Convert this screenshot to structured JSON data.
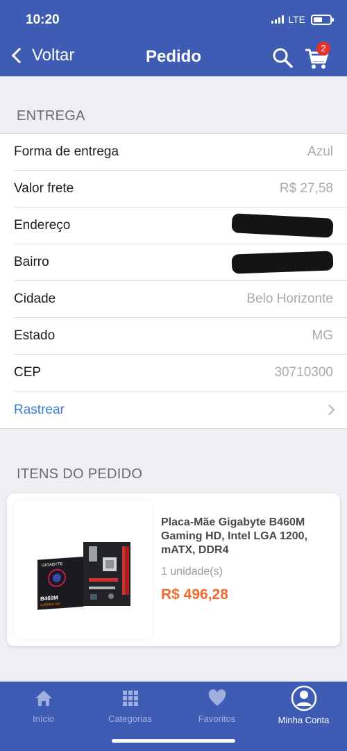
{
  "status_bar": {
    "time": "10:20",
    "network": "LTE"
  },
  "header": {
    "back_label": "Voltar",
    "title": "Pedido",
    "cart_badge": "2"
  },
  "delivery": {
    "section_title": "ENTREGA",
    "rows": [
      {
        "label": "Forma de entrega",
        "value": "Azul"
      },
      {
        "label": "Valor frete",
        "value": "R$ 27,58"
      },
      {
        "label": "Endereço",
        "value": ""
      },
      {
        "label": "Bairro",
        "value": ""
      },
      {
        "label": "Cidade",
        "value": "Belo Horizonte"
      },
      {
        "label": "Estado",
        "value": "MG"
      },
      {
        "label": "CEP",
        "value": "30710300"
      }
    ],
    "track_label": "Rastrear"
  },
  "items": {
    "section_title": "ITENS DO PEDIDO",
    "product": {
      "name": "Placa-Mãe Gigabyte B460M Gaming HD, Intel LGA 1200, mATX, DDR4",
      "quantity": "1 unidade(s)",
      "price": "R$ 496,28",
      "image_brand": "GIGABYTE",
      "image_model": "B460M",
      "image_series": "GAMING HD"
    }
  },
  "tabbar": {
    "tabs": [
      {
        "label": "Início",
        "icon": "home-icon"
      },
      {
        "label": "Categorias",
        "icon": "grid-icon"
      },
      {
        "label": "Favoritos",
        "icon": "heart-icon"
      },
      {
        "label": "Minha Conta",
        "icon": "user-icon"
      }
    ],
    "active_index": 3
  },
  "colors": {
    "header": "#3f5cb4",
    "price": "#f26a2c",
    "link": "#3a7bd5",
    "badge": "#e5322b"
  }
}
